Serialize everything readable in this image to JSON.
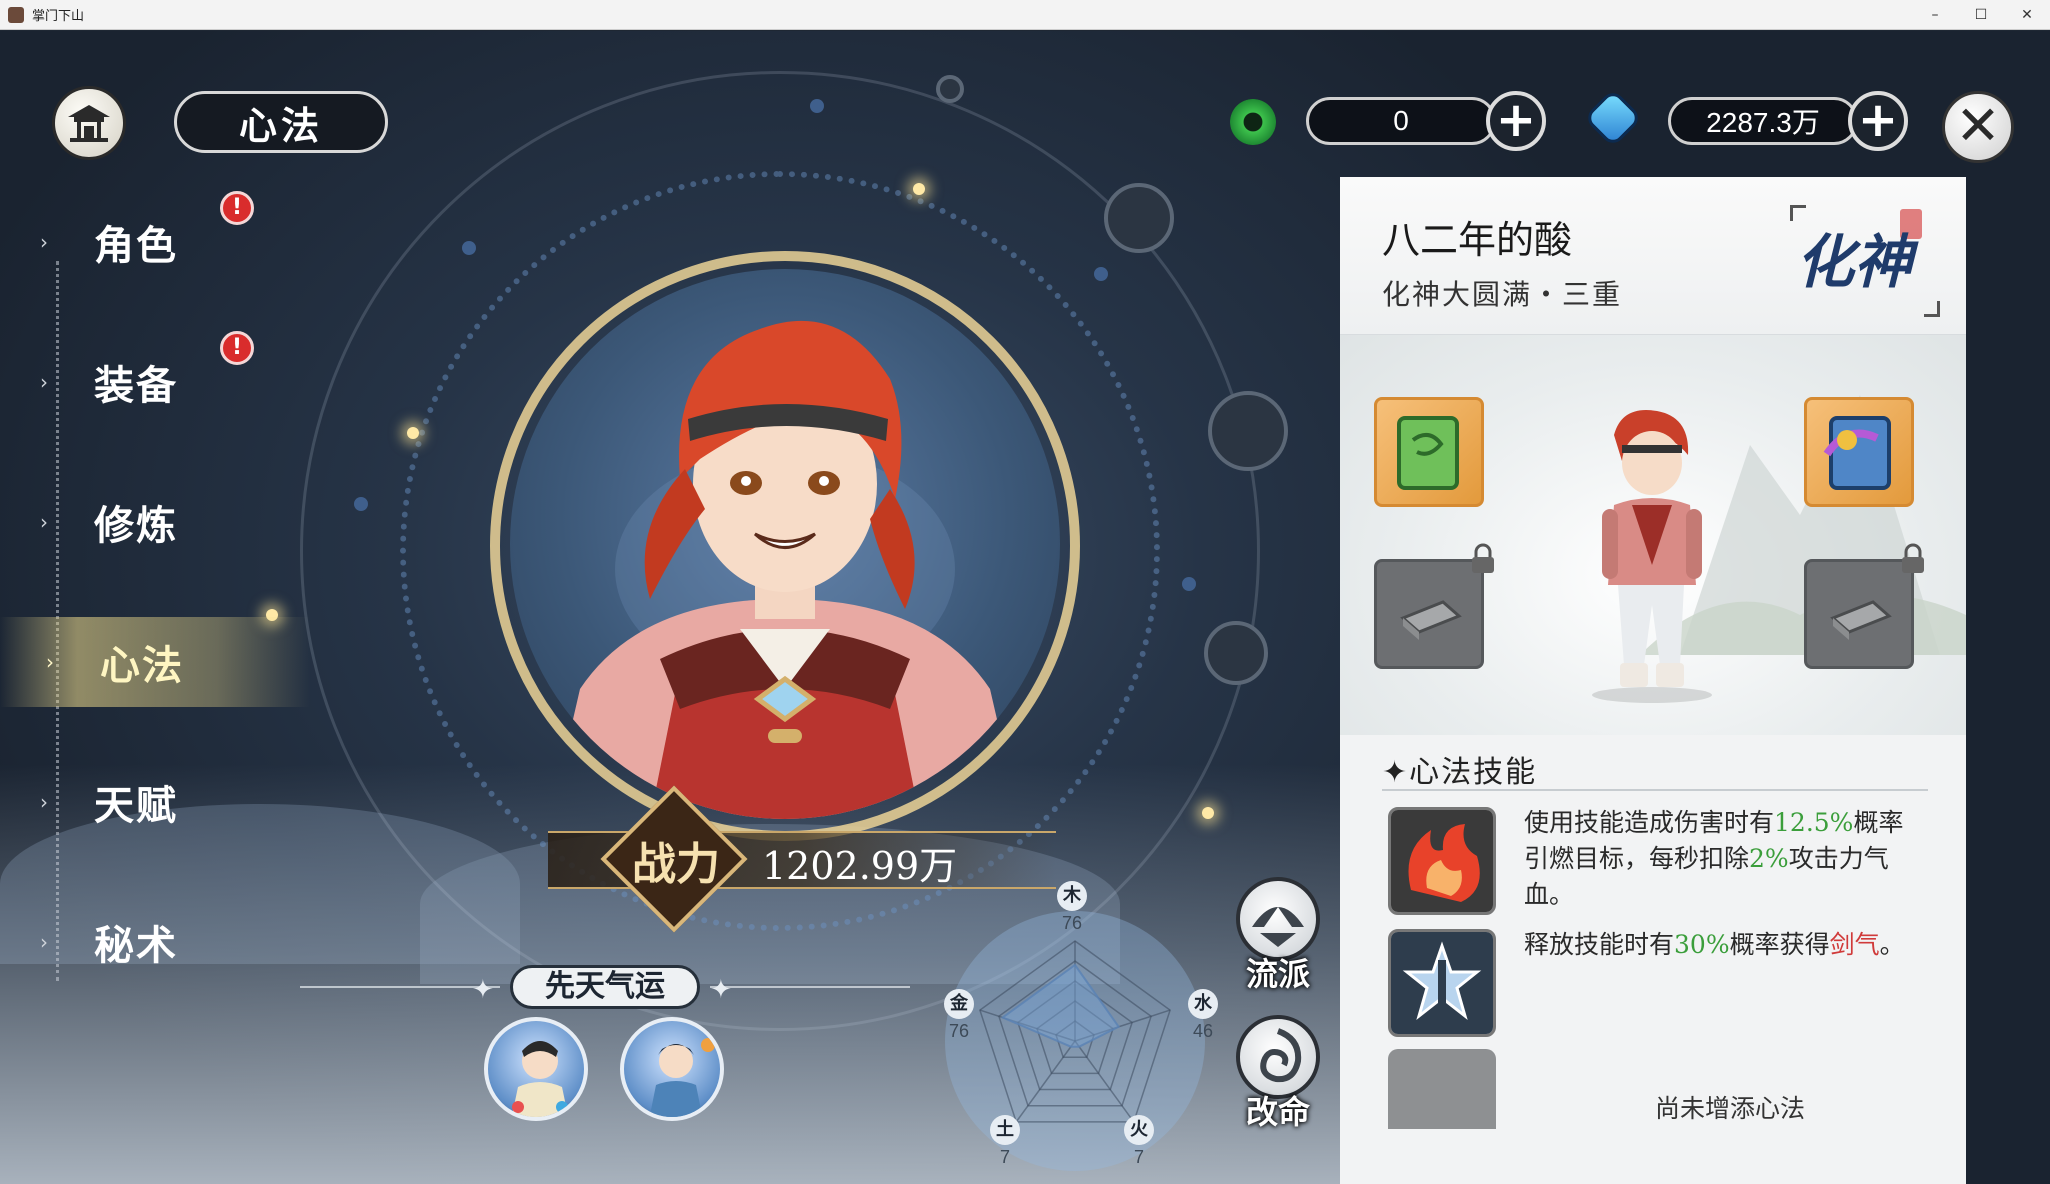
{
  "window": {
    "title": "掌门下山",
    "minimize": "–",
    "maximize": "☐",
    "close": "✕"
  },
  "header": {
    "page_title": "心法",
    "currency1": {
      "icon": "jade-ring-icon",
      "value": "0",
      "add": "+"
    },
    "currency2": {
      "icon": "spirit-gem-icon",
      "value": "2287.3万",
      "add": "+"
    },
    "close": "✕"
  },
  "sidebar": {
    "items": [
      {
        "label": "角色",
        "arrow": "›",
        "alert": "!"
      },
      {
        "label": "装备",
        "arrow": "›",
        "alert": "!"
      },
      {
        "label": "修炼",
        "arrow": "›"
      },
      {
        "label": "心法",
        "arrow": "›",
        "active": true
      },
      {
        "label": "天赋",
        "arrow": "›"
      },
      {
        "label": "秘术",
        "arrow": "›"
      }
    ]
  },
  "power": {
    "label": "战力",
    "value": "1202.99万"
  },
  "destiny": {
    "title": "先天气运",
    "star": "✦"
  },
  "elements": [
    {
      "name": "木",
      "value": "76"
    },
    {
      "name": "水",
      "value": "46"
    },
    {
      "name": "火",
      "value": "7"
    },
    {
      "name": "土",
      "value": "7"
    },
    {
      "name": "金",
      "value": "76"
    }
  ],
  "actions": {
    "school": "流派",
    "fate": "改命"
  },
  "panel": {
    "name": "八二年的酸",
    "realm": "化神大圆满・三重",
    "realm_badge": "化神",
    "skills_title": "✦心法技能",
    "skills": [
      {
        "icon": "flaming-fist-icon",
        "text_parts": [
          "使用技能造成伤害时有",
          "12.5%",
          "概率引燃目标，每秒扣除",
          "2%",
          "攻击力气血。"
        ]
      },
      {
        "icon": "sword-emblem-icon",
        "text_parts": [
          "释放技能时有",
          "30%",
          "概率获得",
          "剑气",
          "。"
        ]
      }
    ],
    "empty_text": "尚未增添心法"
  },
  "colors": {
    "gold": "#ecd396",
    "panel_bg": "#f2f3f4",
    "highlight_green": "#3b9e3b",
    "highlight_red": "#d03a3a",
    "alert_red": "#d92c2c"
  }
}
